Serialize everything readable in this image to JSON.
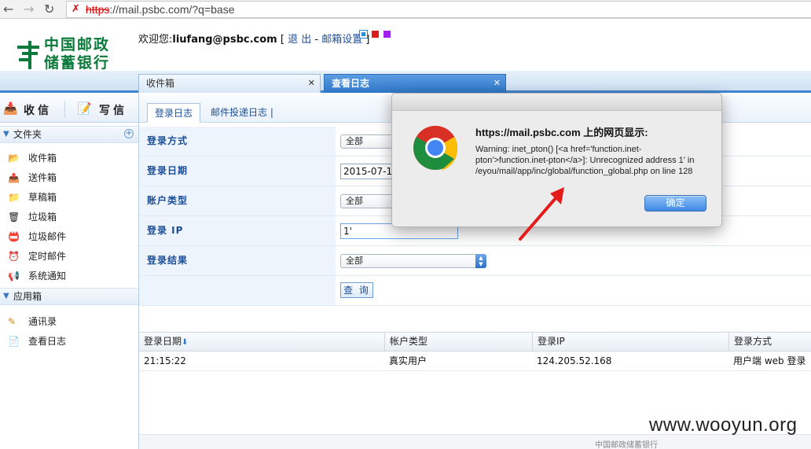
{
  "browser": {
    "url_scheme": "https",
    "url_rest": "://mail.psbc.com/?q=base",
    "back": "←",
    "forward": "→",
    "reload": "↻",
    "warning": "✗"
  },
  "header": {
    "logo_line1": "中国邮政",
    "logo_line2": "储蓄银行",
    "welcome_prefix": "欢迎您:",
    "user_email": "liufang@psbc.com",
    "bracket_open": "[",
    "logout": "退 出",
    "dash": "-",
    "mailbox_settings": "邮箱设置",
    "bracket_close": "]",
    "skin_colors": [
      "#2a8bd6",
      "#e01b1b",
      "#a020f0"
    ]
  },
  "tabs": [
    {
      "label": "收件箱",
      "close": "✕"
    },
    {
      "label": "查看日志",
      "close": "✕"
    }
  ],
  "sidebar": {
    "receive": "收信",
    "write": "写信",
    "folders_head": "文件夹",
    "plus": "+",
    "folders": [
      {
        "label": "收件箱",
        "icon": "inbox-icon",
        "glyph": "📂"
      },
      {
        "label": "送件箱",
        "icon": "outbox-icon",
        "glyph": "📤"
      },
      {
        "label": "草稿箱",
        "icon": "drafts-icon",
        "glyph": "📁"
      },
      {
        "label": "垃圾箱",
        "icon": "trash-icon",
        "glyph": "🗑"
      },
      {
        "label": "垃圾邮件",
        "icon": "spam-icon",
        "glyph": "📛"
      },
      {
        "label": "定时邮件",
        "icon": "scheduled-icon",
        "glyph": "⏰"
      },
      {
        "label": "系统通知",
        "icon": "notice-icon",
        "glyph": "📢"
      }
    ],
    "apps_head": "应用箱",
    "apps": [
      {
        "label": "通讯录",
        "icon": "contacts-icon",
        "glyph": "✎"
      },
      {
        "label": "查看日志",
        "icon": "log-icon",
        "glyph": "📄"
      }
    ]
  },
  "main": {
    "subtabs": [
      "登录日志",
      "邮件投递日志",
      "|"
    ],
    "form": {
      "login_method_label": "登录方式",
      "login_method_value": "全部",
      "login_date_label": "登录日期",
      "login_date_value": "2015-07-1",
      "account_type_label": "账户类型",
      "account_type_value": "全部",
      "login_ip_label": "登录 IP",
      "login_ip_value": "1'",
      "login_result_label": "登录结果",
      "login_result_value": "全部",
      "query_button": "查 询"
    },
    "table": {
      "headers": [
        "登录日期",
        "帐户类型",
        "登录IP",
        "登录方式"
      ],
      "sort_glyph": "⬇",
      "rows": [
        [
          "21:15:22",
          "真实用户",
          "124.205.52.168",
          "用户端 web 登录"
        ]
      ]
    },
    "footer_partial": "中国邮政储蓄银行"
  },
  "dialog": {
    "title": "https://mail.psbc.com 上的网页显示:",
    "message": "Warning: inet_pton() [<a href='function.inet-pton'>function.inet-pton</a>]: Unrecognized address 1' in /eyou/mail/app/inc/global/function_global.php on line 128",
    "ok": "确定"
  },
  "watermark": "www.wooyun.org"
}
